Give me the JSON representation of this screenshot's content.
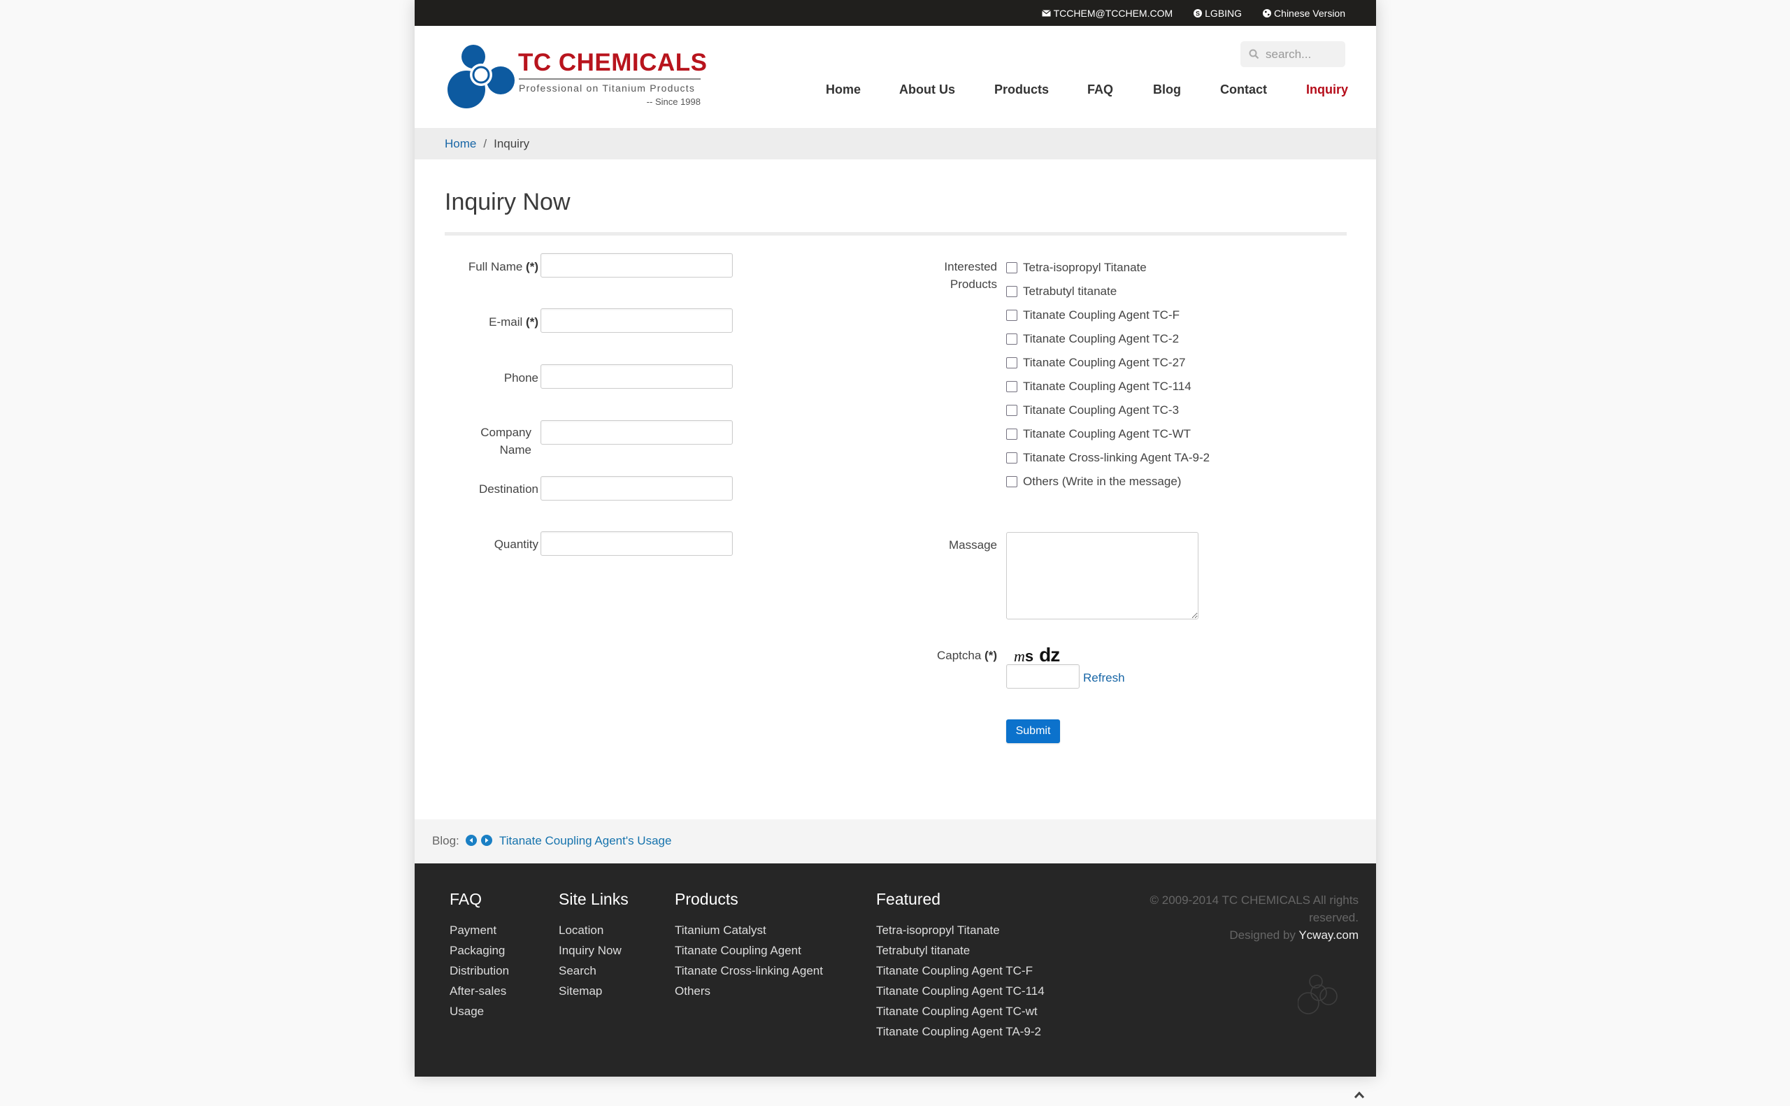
{
  "topbar": {
    "email": "TCCHEM@TCCHEM.COM",
    "skype": "LGBING",
    "language": "Chinese Version"
  },
  "brand": {
    "name": "TC CHEMICALS",
    "tagline": "Professional on Titanium Products",
    "since": "-- Since 1998"
  },
  "search": {
    "placeholder": "search..."
  },
  "nav": {
    "items": [
      {
        "label": "Home"
      },
      {
        "label": "About Us"
      },
      {
        "label": "Products"
      },
      {
        "label": "FAQ"
      },
      {
        "label": "Blog"
      },
      {
        "label": "Contact"
      },
      {
        "label": "Inquiry",
        "active": true
      }
    ],
    "active_color": "#b50d1a"
  },
  "breadcrumb": {
    "home": "Home",
    "separator": "/",
    "current": "Inquiry"
  },
  "page_title": "Inquiry Now",
  "form": {
    "fields": [
      {
        "label": "Full Name",
        "required": "(*)",
        "value": ""
      },
      {
        "label": "E-mail",
        "required": "(*)",
        "value": ""
      },
      {
        "label": "Phone",
        "value": ""
      },
      {
        "label": "Company Name",
        "value": ""
      },
      {
        "label": "Destination",
        "value": ""
      },
      {
        "label": "Quantity",
        "value": ""
      }
    ],
    "products_label": "Interested Products",
    "products": [
      {
        "label": "Tetra-isopropyl Titanate",
        "checked": false
      },
      {
        "label": "Tetrabutyl titanate",
        "checked": false
      },
      {
        "label": "Titanate Coupling Agent TC-F",
        "checked": false
      },
      {
        "label": "Titanate Coupling Agent TC-2",
        "checked": false
      },
      {
        "label": "Titanate Coupling Agent TC-27",
        "checked": false
      },
      {
        "label": "Titanate Coupling Agent TC-114",
        "checked": false
      },
      {
        "label": "Titanate Coupling Agent TC-3",
        "checked": false
      },
      {
        "label": "Titanate Coupling Agent TC-WT",
        "checked": false
      },
      {
        "label": "Titanate Cross-linking Agent TA-9-2",
        "checked": false
      },
      {
        "label": "Others (Write in the message)",
        "checked": false
      }
    ],
    "message_label": "Massage",
    "message_value": "",
    "captcha_label": "Captcha",
    "captcha_required": "(*)",
    "captcha_text": {
      "part1": "m",
      "part2": "s",
      "part3": "dz"
    },
    "captcha_value": "",
    "refresh_label": "Refresh",
    "submit_label": "Submit",
    "submit_color": "#0c72cc"
  },
  "blog": {
    "label": "Blog:",
    "title": "Titanate Coupling Agent's Usage"
  },
  "footer": {
    "columns": [
      {
        "title": "FAQ",
        "links": [
          "Payment",
          "Packaging",
          "Distribution",
          "After-sales",
          "Usage"
        ]
      },
      {
        "title": "Site Links",
        "links": [
          "Location",
          "Inquiry Now",
          "Search",
          "Sitemap"
        ]
      },
      {
        "title": "Products",
        "links": [
          "Titanium Catalyst",
          "Titanate Coupling Agent",
          "Titanate Cross-linking Agent",
          "Others"
        ]
      },
      {
        "title": "Featured",
        "links": [
          "Tetra-isopropyl Titanate",
          "Tetrabutyl titanate",
          "Titanate Coupling Agent TC-F",
          "Titanate Coupling Agent TC-114",
          "Titanate Coupling Agent TC-wt",
          "Titanate Coupling Agent TA-9-2"
        ]
      }
    ],
    "copyright": "© 2009-2014 TC CHEMICALS All rights reserved.",
    "designed_by": "Designed by",
    "designer": "Ycway.com"
  },
  "colors": {
    "brand_red": "#b8141d",
    "link_blue": "#1866a6",
    "topbar_bg": "#201f1d",
    "footer_bg": "#262626"
  }
}
